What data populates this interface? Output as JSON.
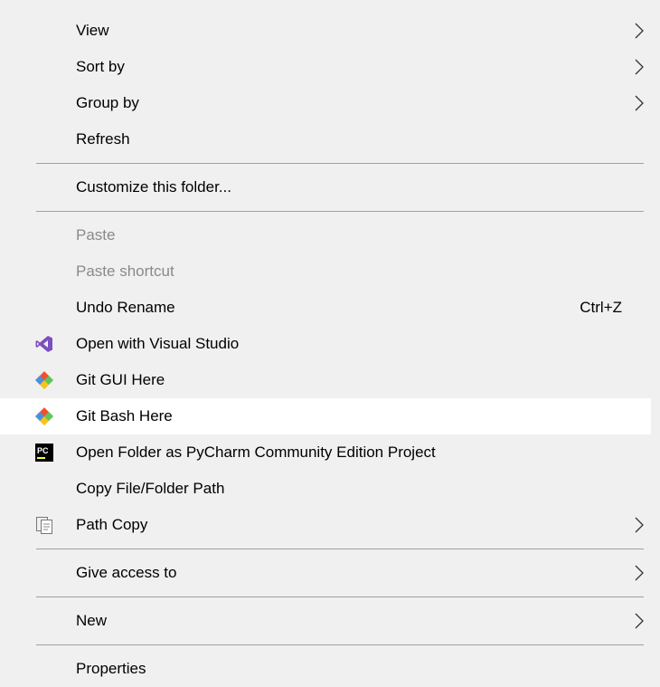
{
  "menu": {
    "group1": [
      {
        "label": "View",
        "submenu": true
      },
      {
        "label": "Sort by",
        "submenu": true
      },
      {
        "label": "Group by",
        "submenu": true
      },
      {
        "label": "Refresh"
      }
    ],
    "customize_label": "Customize this folder...",
    "group3": {
      "paste_label": "Paste",
      "paste_shortcut_label": "Paste shortcut",
      "undo_label": "Undo Rename",
      "undo_shortcut": "Ctrl+Z",
      "visual_studio_label": "Open with Visual Studio",
      "git_gui_label": "Git GUI Here",
      "git_bash_label": "Git Bash Here",
      "pycharm_label": "Open Folder as PyCharm Community Edition Project",
      "pycharm_icon_text": "PC",
      "copy_path_label": "Copy File/Folder Path",
      "path_copy_label": "Path Copy"
    },
    "give_access_label": "Give access to",
    "new_label": "New",
    "properties_label": "Properties"
  },
  "colors": {
    "background": "#f0f0f0",
    "hover": "#ffffff",
    "separator": "#a0a0a0",
    "disabled_text": "#8a8a8a",
    "visual_studio": "#7b4fbf",
    "git_orange": "#f05133",
    "pycharm_bg": "#000000",
    "pycharm_accent": "#fcf84a"
  },
  "icons": [
    "visual-studio-icon",
    "git-gui-icon",
    "git-bash-icon",
    "pycharm-icon",
    "path-copy-icon",
    "chevron-right-icon"
  ]
}
